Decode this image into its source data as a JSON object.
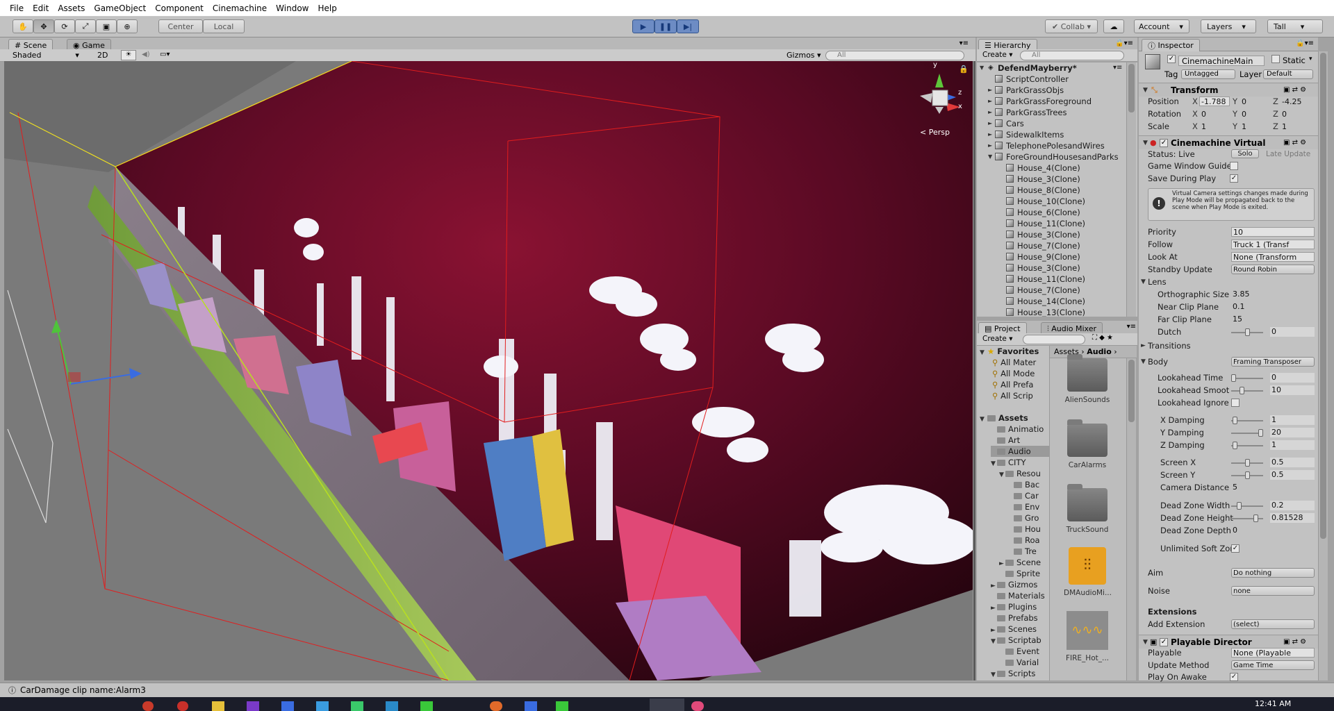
{
  "menu": [
    "File",
    "Edit",
    "Assets",
    "GameObject",
    "Component",
    "Cinemachine",
    "Window",
    "Help"
  ],
  "toolbar": {
    "pivot": "Center",
    "space": "Local",
    "collab": "Collab",
    "account": "Account",
    "layers": "Layers",
    "layout": "Tall"
  },
  "scene": {
    "tab_scene": "Scene",
    "tab_game": "Game",
    "shading": "Shaded",
    "mode2d": "2D",
    "gizmos": "Gizmos",
    "search_placeholder": "All",
    "persp": "Persp",
    "axes": {
      "x": "x",
      "y": "y",
      "z": "z"
    }
  },
  "hierarchy": {
    "tab": "Hierarchy",
    "create": "Create",
    "search_placeholder": "All",
    "root": "DefendMayberry*",
    "items": [
      {
        "label": "ScriptController",
        "depth": 1,
        "arrow": ""
      },
      {
        "label": "ParkGrassObjs",
        "depth": 1,
        "arrow": "►"
      },
      {
        "label": "ParkGrassForeground",
        "depth": 1,
        "arrow": "►"
      },
      {
        "label": "ParkGrassTrees",
        "depth": 1,
        "arrow": "►"
      },
      {
        "label": "Cars",
        "depth": 1,
        "arrow": "►"
      },
      {
        "label": "SidewalkItems",
        "depth": 1,
        "arrow": "►"
      },
      {
        "label": "TelephonePolesandWires",
        "depth": 1,
        "arrow": "►"
      },
      {
        "label": "ForeGroundHousesandParks",
        "depth": 1,
        "arrow": "▼"
      },
      {
        "label": "House_4(Clone)",
        "depth": 2,
        "arrow": ""
      },
      {
        "label": "House_3(Clone)",
        "depth": 2,
        "arrow": ""
      },
      {
        "label": "House_8(Clone)",
        "depth": 2,
        "arrow": ""
      },
      {
        "label": "House_10(Clone)",
        "depth": 2,
        "arrow": ""
      },
      {
        "label": "House_6(Clone)",
        "depth": 2,
        "arrow": ""
      },
      {
        "label": "House_11(Clone)",
        "depth": 2,
        "arrow": ""
      },
      {
        "label": "House_3(Clone)",
        "depth": 2,
        "arrow": ""
      },
      {
        "label": "House_7(Clone)",
        "depth": 2,
        "arrow": ""
      },
      {
        "label": "House_9(Clone)",
        "depth": 2,
        "arrow": ""
      },
      {
        "label": "House_3(Clone)",
        "depth": 2,
        "arrow": ""
      },
      {
        "label": "House_11(Clone)",
        "depth": 2,
        "arrow": ""
      },
      {
        "label": "House_7(Clone)",
        "depth": 2,
        "arrow": ""
      },
      {
        "label": "House_14(Clone)",
        "depth": 2,
        "arrow": ""
      },
      {
        "label": "House_13(Clone)",
        "depth": 2,
        "arrow": ""
      }
    ]
  },
  "project": {
    "tab_project": "Project",
    "tab_mixer": "Audio Mixer",
    "create": "Create",
    "favorites_label": "Favorites",
    "favorites": [
      "All Mater",
      "All Mode",
      "All Prefa",
      "All Scrip"
    ],
    "assets_label": "Assets",
    "tree": [
      {
        "label": "Animatio",
        "depth": 1,
        "arrow": ""
      },
      {
        "label": "Art",
        "depth": 1,
        "arrow": ""
      },
      {
        "label": "Audio",
        "depth": 1,
        "arrow": "",
        "selected": true
      },
      {
        "label": "CITY",
        "depth": 1,
        "arrow": "▼"
      },
      {
        "label": "Resou",
        "depth": 2,
        "arrow": "▼"
      },
      {
        "label": "Bac",
        "depth": 3,
        "arrow": ""
      },
      {
        "label": "Car",
        "depth": 3,
        "arrow": ""
      },
      {
        "label": "Env",
        "depth": 3,
        "arrow": ""
      },
      {
        "label": "Gro",
        "depth": 3,
        "arrow": ""
      },
      {
        "label": "Hou",
        "depth": 3,
        "arrow": ""
      },
      {
        "label": "Roa",
        "depth": 3,
        "arrow": ""
      },
      {
        "label": "Tre",
        "depth": 3,
        "arrow": ""
      },
      {
        "label": "Scene",
        "depth": 2,
        "arrow": "►"
      },
      {
        "label": "Sprite",
        "depth": 2,
        "arrow": ""
      },
      {
        "label": "Gizmos",
        "depth": 1,
        "arrow": "►"
      },
      {
        "label": "Materials",
        "depth": 1,
        "arrow": ""
      },
      {
        "label": "Plugins",
        "depth": 1,
        "arrow": "►"
      },
      {
        "label": "Prefabs",
        "depth": 1,
        "arrow": ""
      },
      {
        "label": "Scenes",
        "depth": 1,
        "arrow": "►"
      },
      {
        "label": "Scriptab",
        "depth": 1,
        "arrow": "▼"
      },
      {
        "label": "Event",
        "depth": 2,
        "arrow": ""
      },
      {
        "label": "Varial",
        "depth": 2,
        "arrow": ""
      },
      {
        "label": "Scripts",
        "depth": 1,
        "arrow": "▼"
      }
    ],
    "breadcrumb": [
      "Assets",
      "Audio"
    ],
    "assets": [
      {
        "label": "AlienSounds",
        "kind": "folder"
      },
      {
        "label": "CarAlarms",
        "kind": "folder"
      },
      {
        "label": "TruckSound",
        "kind": "folder"
      },
      {
        "label": "DMAudioMi...",
        "kind": "mixer"
      },
      {
        "label": "FIRE_Hot_...",
        "kind": "audio"
      }
    ]
  },
  "inspector": {
    "tab": "Inspector",
    "object_name": "CinemachineMain",
    "static_label": "Static",
    "tag_label": "Tag",
    "tag_value": "Untagged",
    "layer_label": "Layer",
    "layer_value": "Default",
    "transform": {
      "title": "Transform",
      "rows": [
        {
          "label": "Position",
          "x": "-1.788",
          "y": "0",
          "z": "-4.25"
        },
        {
          "label": "Rotation",
          "x": "0",
          "y": "0",
          "z": "0"
        },
        {
          "label": "Scale",
          "x": "1",
          "y": "1",
          "z": "1"
        }
      ]
    },
    "cinemachine": {
      "title": "Cinemachine Virtual",
      "status_label": "Status: Live",
      "solo": "Solo",
      "late_update": "Late Update",
      "game_window_guides": "Game Window Guide",
      "save_during_play": "Save During Play",
      "help_text": "Virtual Camera settings changes made during Play Mode will be propagated back to the scene when Play Mode is exited.",
      "priority_label": "Priority",
      "priority_value": "10",
      "follow_label": "Follow",
      "follow_value": "Truck 1 (Transf",
      "lookat_label": "Look At",
      "lookat_value": "None (Transform",
      "standby_label": "Standby Update",
      "standby_value": "Round Robin",
      "lens_label": "Lens",
      "ortho_label": "Orthographic Size",
      "ortho_value": "3.85",
      "near_label": "Near Clip Plane",
      "near_value": "0.1",
      "far_label": "Far Clip Plane",
      "far_value": "15",
      "dutch_label": "Dutch",
      "dutch_value": "0",
      "transitions_label": "Transitions",
      "body_label": "Body",
      "body_value": "Framing Transposer",
      "lookahead_time_label": "Lookahead Time",
      "lookahead_time_value": "0",
      "lookahead_smooth_label": "Lookahead Smoot",
      "lookahead_smooth_value": "10",
      "lookahead_ignore_label": "Lookahead Ignore",
      "xdamp_label": "X Damping",
      "xdamp_value": "1",
      "ydamp_label": "Y Damping",
      "ydamp_value": "20",
      "zdamp_label": "Z Damping",
      "zdamp_value": "1",
      "screenx_label": "Screen X",
      "screenx_value": "0.5",
      "screeny_label": "Screen Y",
      "screeny_value": "0.5",
      "camdist_label": "Camera Distance",
      "camdist_value": "5",
      "dzw_label": "Dead Zone Width",
      "dzw_value": "0.2",
      "dzh_label": "Dead Zone Height",
      "dzh_value": "0.81528",
      "dzd_label": "Dead Zone Depth",
      "dzd_value": "0",
      "unlimited_label": "Unlimited Soft Zor",
      "aim_label": "Aim",
      "aim_value": "Do nothing",
      "noise_label": "Noise",
      "noise_value": "none",
      "extensions_label": "Extensions",
      "add_ext_label": "Add Extension",
      "add_ext_value": "(select)"
    },
    "playable": {
      "title": "Playable Director",
      "playable_label": "Playable",
      "playable_value": "None (Playable",
      "update_label": "Update Method",
      "update_value": "Game Time",
      "playonawake_label": "Play On Awake"
    }
  },
  "status": {
    "message": "CarDamage clip name:Alarm3"
  },
  "taskbar": {
    "time": "12:41 AM"
  },
  "colors": {
    "sky": "#5a0a24",
    "play_blue": "#6d8cc4"
  }
}
